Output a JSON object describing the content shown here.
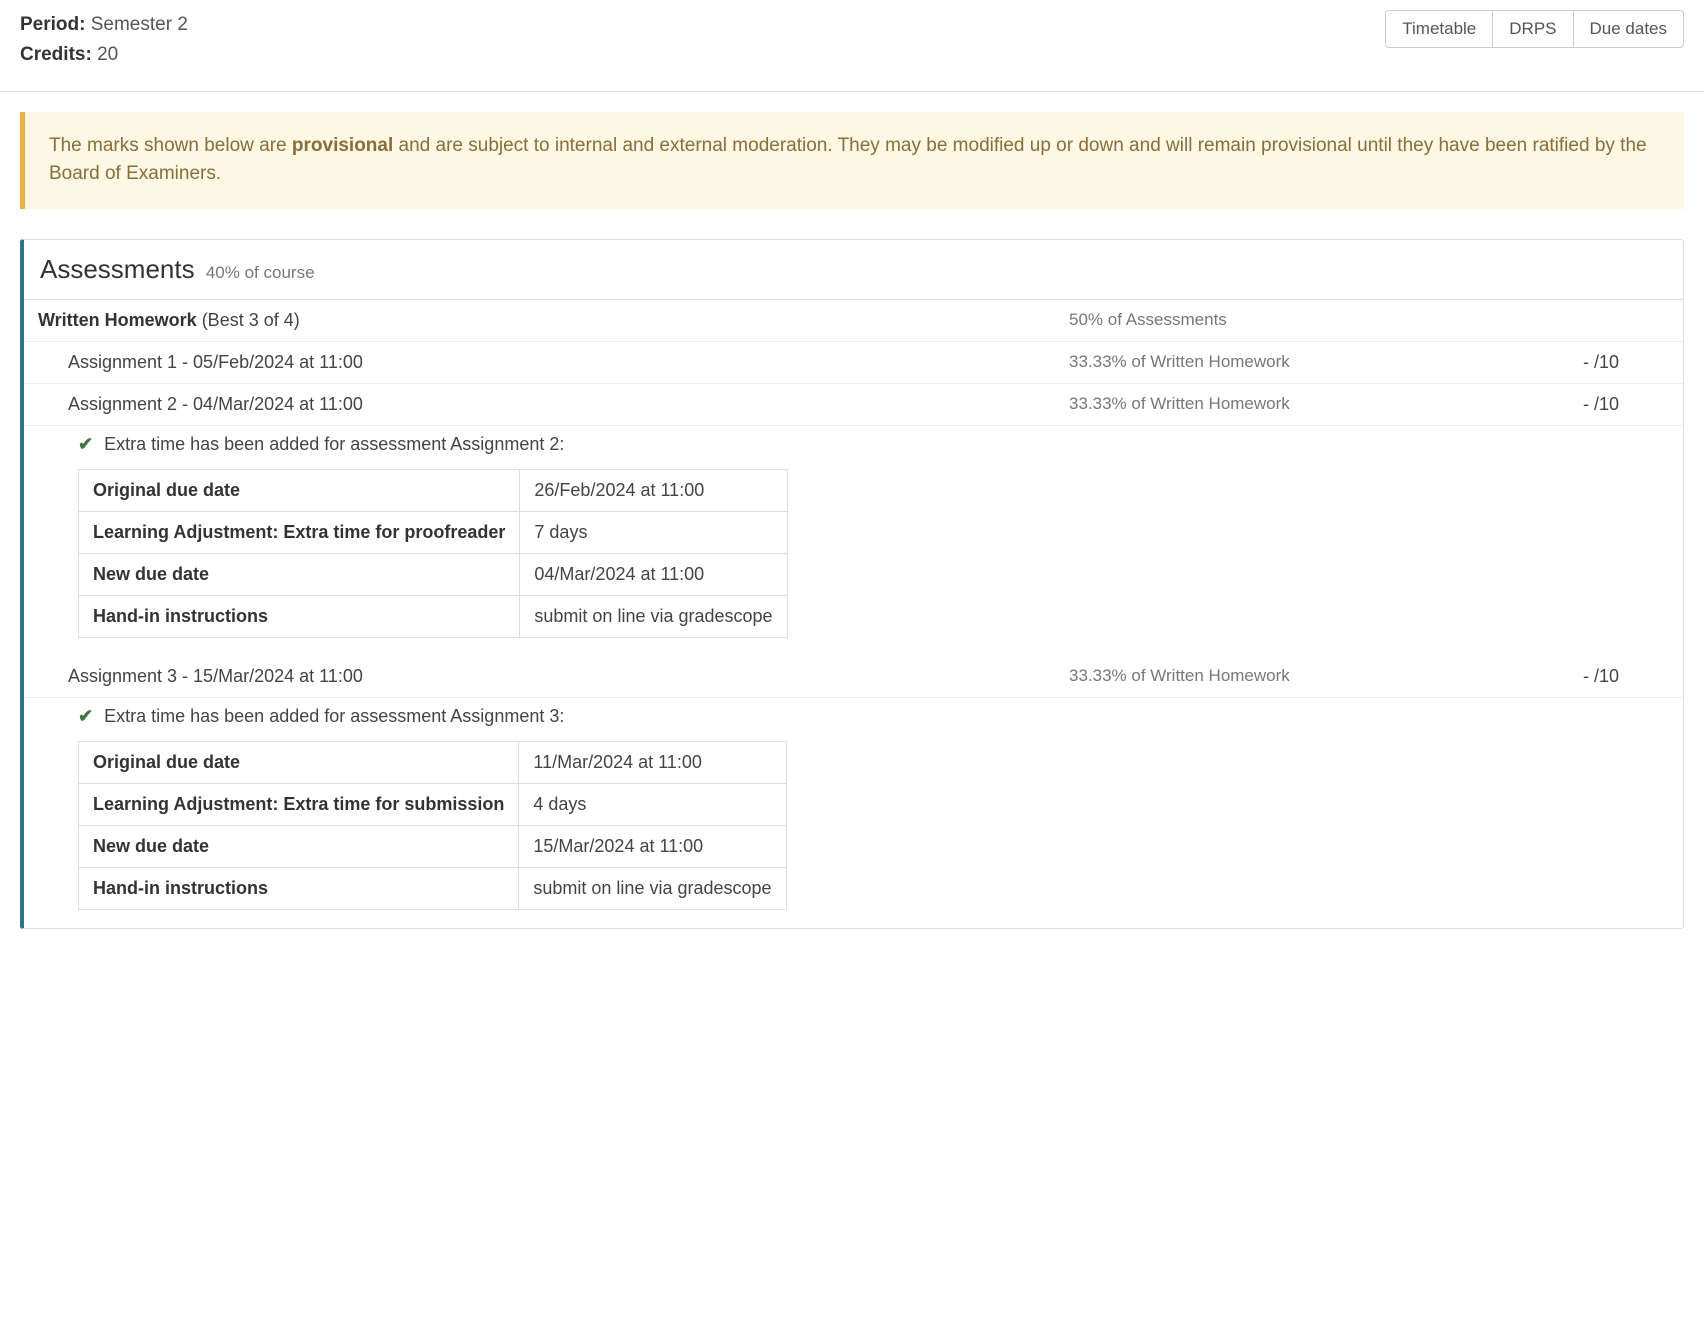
{
  "meta": {
    "period_label": "Period:",
    "period_value": "Semester 2",
    "credits_label": "Credits:",
    "credits_value": "20"
  },
  "buttons": {
    "timetable": "Timetable",
    "drps": "DRPS",
    "due_dates": "Due dates"
  },
  "alert": {
    "pre": "The marks shown below are ",
    "bold": "provisional",
    "post": " and are subject to internal and external moderation. They may be modified up or down and will remain provisional until they have been ratified by the Board of Examiners."
  },
  "panel": {
    "title": "Assessments",
    "subtitle": "40% of course"
  },
  "group": {
    "title": "Written Homework",
    "rule": " (Best 3 of 4)",
    "weight": "50% of Assessments"
  },
  "items": [
    {
      "label": "Assignment 1 - 05/Feb/2024 at 11:00",
      "weight": "33.33% of Written Homework",
      "mark": "- /10",
      "extension": null
    },
    {
      "label": "Assignment 2 - 04/Mar/2024 at 11:00",
      "weight": "33.33% of Written Homework",
      "mark": "- /10",
      "extension": {
        "msg": "Extra time has been added for assessment Assignment 2:",
        "rows": [
          {
            "k": "Original due date",
            "v": "26/Feb/2024 at 11:00"
          },
          {
            "k": "Learning Adjustment: Extra time for proofreader",
            "v": "7 days"
          },
          {
            "k": "New due date",
            "v": "04/Mar/2024 at 11:00"
          },
          {
            "k": "Hand-in instructions",
            "v": "submit on line via gradescope"
          }
        ]
      }
    },
    {
      "label": "Assignment 3 - 15/Mar/2024 at 11:00",
      "weight": "33.33% of Written Homework",
      "mark": "- /10",
      "extension": {
        "msg": "Extra time has been added for assessment Assignment 3:",
        "rows": [
          {
            "k": "Original due date",
            "v": "11/Mar/2024 at 11:00"
          },
          {
            "k": "Learning Adjustment: Extra time for submission",
            "v": "4 days"
          },
          {
            "k": "New due date",
            "v": "15/Mar/2024 at 11:00"
          },
          {
            "k": "Hand-in instructions",
            "v": "submit on line via gradescope"
          }
        ]
      }
    }
  ]
}
